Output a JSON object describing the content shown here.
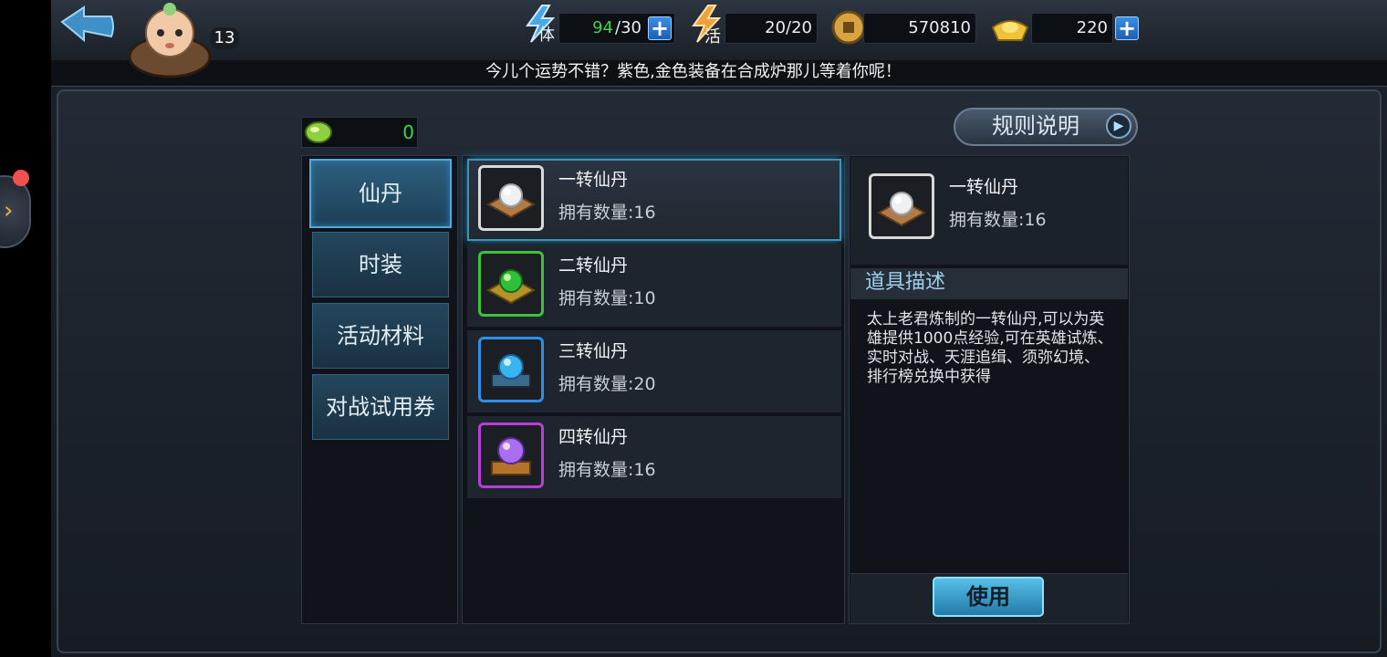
{
  "header": {
    "level": "13",
    "stamina": {
      "label": "体",
      "current": "94",
      "max": "/30"
    },
    "vitality": {
      "label": "活",
      "value": "20/20"
    },
    "coins": "570810",
    "ingots": "220"
  },
  "ticker": "今儿个运势不错？紫色,金色装备在合成炉那儿等着你呢！",
  "currency": {
    "value": "0"
  },
  "rules_button": "规则说明",
  "categories": [
    {
      "label": "仙丹",
      "active": true
    },
    {
      "label": "时装",
      "active": false
    },
    {
      "label": "活动材料",
      "active": false
    },
    {
      "label": "对战试用券",
      "active": false
    }
  ],
  "items": [
    {
      "name": "一转仙丹",
      "count": "拥有数量:16",
      "color": "#c9c9c9",
      "orb": "#e8ecef"
    },
    {
      "name": "二转仙丹",
      "count": "拥有数量:10",
      "color": "#3fbf3a",
      "orb": "#2fbf3a"
    },
    {
      "name": "三转仙丹",
      "count": "拥有数量:20",
      "color": "#2f8fe6",
      "orb": "#39b4f0"
    },
    {
      "name": "四转仙丹",
      "count": "拥有数量:16",
      "color": "#b63fd8",
      "orb": "#a86ff0"
    }
  ],
  "detail": {
    "name": "一转仙丹",
    "count": "拥有数量:16",
    "section_title": "道具描述",
    "description": "太上老君炼制的一转仙丹,可以为英雄提供1000点经验,可在英雄试炼、实时对战、天涯追缉、须弥幻境、排行榜兑换中获得",
    "use_button": "使用"
  }
}
